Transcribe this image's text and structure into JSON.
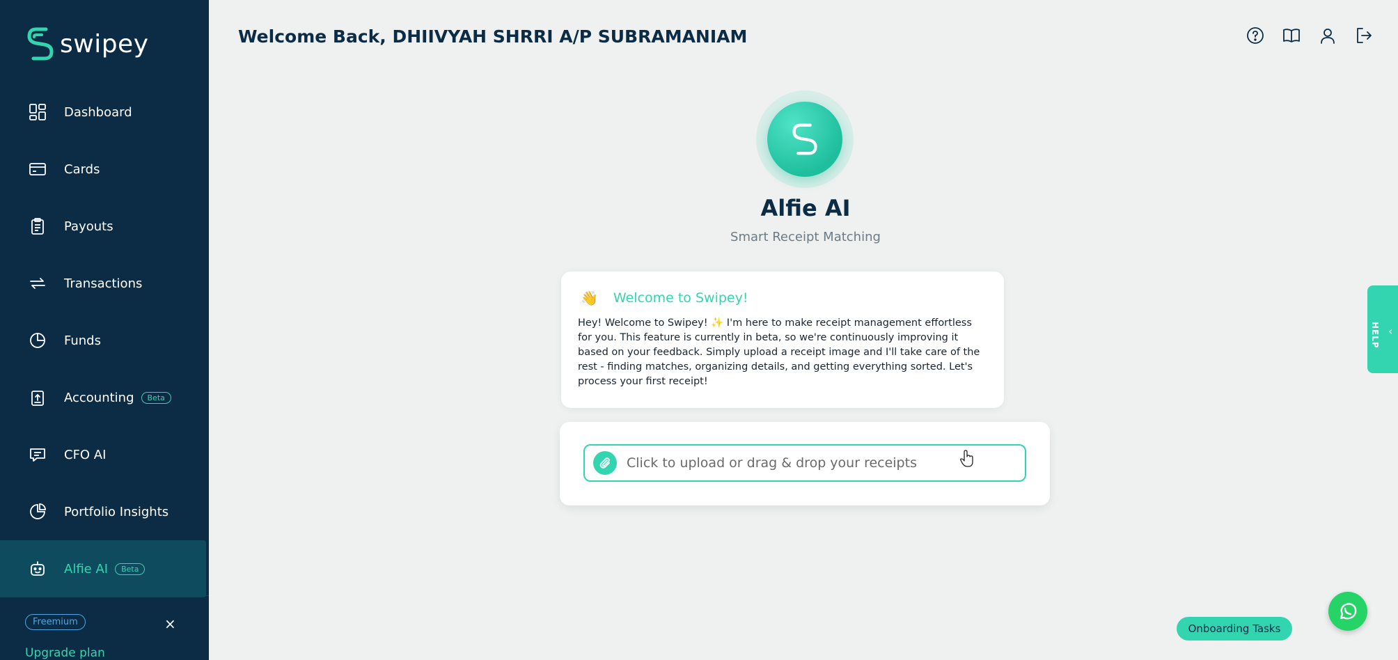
{
  "app": {
    "name": "swipey"
  },
  "colors": {
    "sidebar_bg": "#0c2c45",
    "accent": "#33d4b0",
    "active_bg": "#0f4b5e"
  },
  "sidebar": {
    "items": [
      {
        "label": "Dashboard",
        "icon": "dashboard-grid-icon"
      },
      {
        "label": "Cards",
        "icon": "credit-card-icon"
      },
      {
        "label": "Payouts",
        "icon": "clipboard-icon"
      },
      {
        "label": "Transactions",
        "icon": "transfer-arrows-icon"
      },
      {
        "label": "Funds",
        "icon": "pie-chart-icon"
      },
      {
        "label": "Accounting",
        "icon": "clipboard-upload-icon",
        "badge": "Beta"
      },
      {
        "label": "CFO AI",
        "icon": "chat-bubble-icon"
      },
      {
        "label": "Portfolio Insights",
        "icon": "pie-slice-icon"
      },
      {
        "label": "Alfie AI",
        "icon": "robot-icon",
        "badge": "Beta",
        "active": true
      }
    ],
    "plan_badge": "Freemium",
    "close_label": "×",
    "upgrade_label": "Upgrade plan"
  },
  "header": {
    "welcome": "Welcome Back, DHIIVYAH SHRRI A/P SUBRAMANIAM",
    "icons": [
      "help-circle-icon",
      "book-icon",
      "user-icon",
      "logout-icon"
    ]
  },
  "assistant": {
    "title": "Alfie AI",
    "subtitle": "Smart Receipt Matching"
  },
  "welcome_card": {
    "emoji": "👋",
    "title": "Welcome to Swipey!",
    "body": "Hey! Welcome to Swipey! ✨ I'm here to make receipt management effortless for you. This feature is currently in beta, so we're continuously improving it based on your feedback. Simply upload a receipt image and I'll take care of the rest - finding matches, organizing details, and getting everything sorted. Let's process your first receipt!"
  },
  "upload": {
    "label": "Click to upload or drag & drop your receipts"
  },
  "help_tab": {
    "label": "HELP",
    "chevron": "‹"
  },
  "onboarding": {
    "label": "Onboarding Tasks"
  }
}
